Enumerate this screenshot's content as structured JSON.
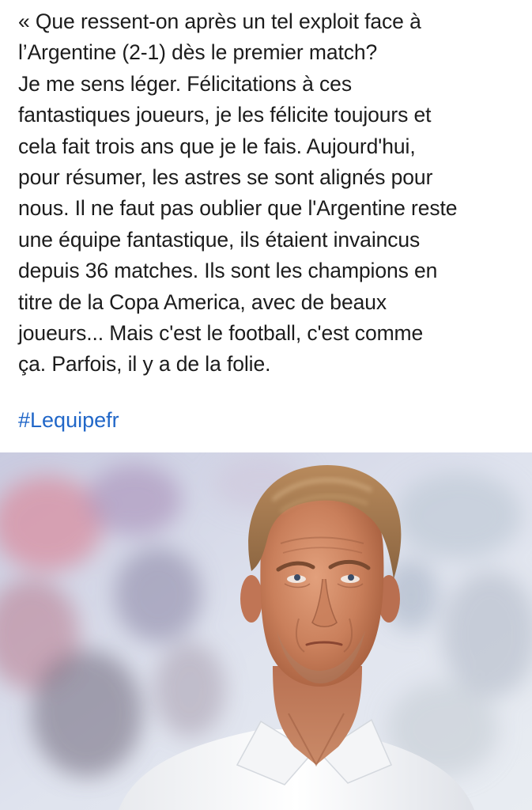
{
  "post": {
    "lines": [
      "« Que ressent-on après un tel exploit face à",
      "l’Argentine (2-1) dès le premier match?",
      "Je me sens léger. Félicitations à ces",
      "fantastiques joueurs, je les félicite toujours et",
      "cela fait trois ans que je le fais. Aujourd'hui,",
      "pour résumer, les astres se sont alignés pour",
      "nous. Il ne faut pas oublier que l'Argentine reste",
      "une équipe fantastique, ils étaient invaincus",
      "depuis 36 matches. Ils sont les champions en",
      "titre de la Copa America, avec de beaux",
      "joueurs... Mais c'est le football, c'est comme",
      "ça. Parfois, il y a de la folie."
    ],
    "hashtag": "#Lequipefr"
  },
  "photo": {
    "subject": "portrait of a man with swept-back blond hair in a white shirt, looking up, blurred stadium crowd behind"
  },
  "colors": {
    "text": "#1c1c1c",
    "hashtag": "#2167c8",
    "background": "#ffffff"
  }
}
